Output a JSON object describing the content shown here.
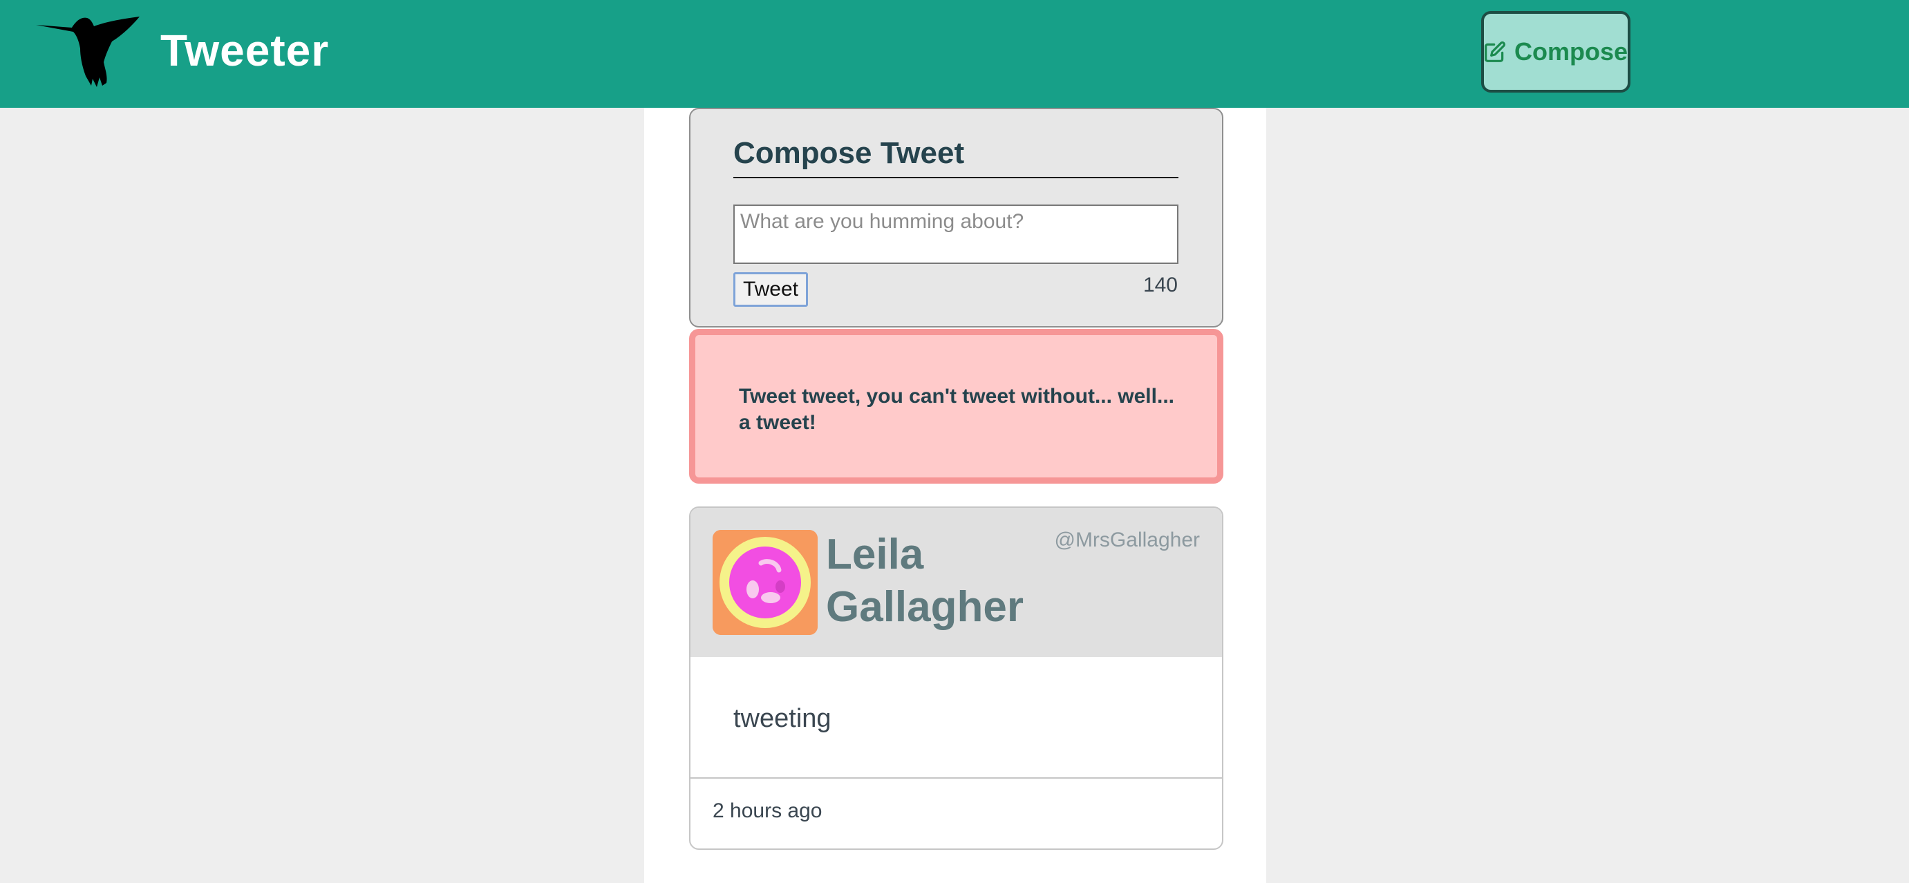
{
  "app": {
    "title": "Tweeter"
  },
  "nav": {
    "compose_label": "Compose"
  },
  "compose": {
    "title": "Compose Tweet",
    "placeholder": "What are you humming about?",
    "submit_label": "Tweet",
    "counter": "140"
  },
  "error": {
    "message": "Tweet tweet, you can't tweet without... well... a tweet!"
  },
  "tweets": [
    {
      "name": "Leila Gallagher",
      "handle": "@MrsGallagher",
      "content": "tweeting",
      "time": "2 hours ago",
      "avatar_icon": "avatar-icon"
    }
  ],
  "colors": {
    "header": "#17a088",
    "compose_nav_bg": "#a1ded2",
    "compose_nav_text": "#1b8a4f",
    "error_bg": "#ffcaca",
    "error_border": "#f69696",
    "text_dark": "#25434d"
  }
}
